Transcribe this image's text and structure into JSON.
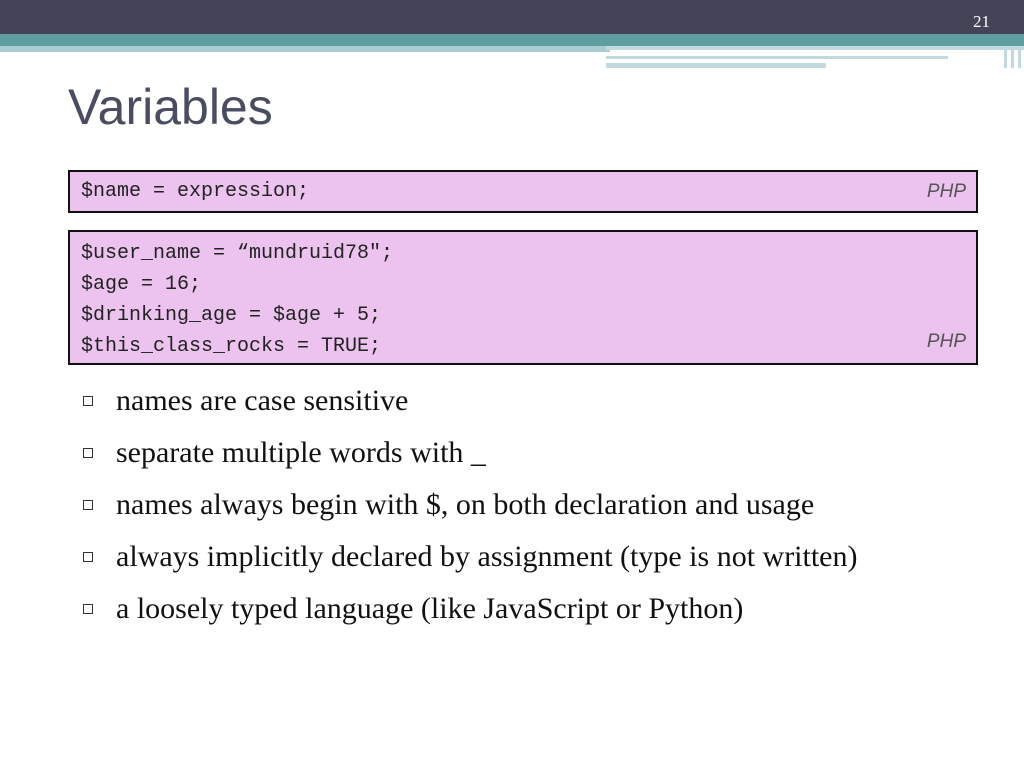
{
  "slide": {
    "number": "21",
    "title": "Variables"
  },
  "syntax_box": {
    "code_lines": [
      "$name = expression;"
    ],
    "language": "PHP"
  },
  "example_box": {
    "code_lines": [
      "$user_name = “mundruid78\";",
      "$age = 16;",
      "$drinking_age = $age + 5;",
      "$this_class_rocks = TRUE;"
    ],
    "language": "PHP"
  },
  "bullets": [
    "names are case sensitive",
    "separate multiple words with _",
    "names always begin with $, on both declaration and usage",
    "always implicitly declared by assignment (type is not written)",
    "a loosely typed language (like JavaScript or Python)"
  ],
  "colors": {
    "header_dark": "#434458",
    "header_teal": "#5f9ea0",
    "code_background": "#ebc3ee",
    "title_text": "#4a4c61"
  },
  "icons": {
    "bullet": "hollow-square-bullet-icon"
  }
}
